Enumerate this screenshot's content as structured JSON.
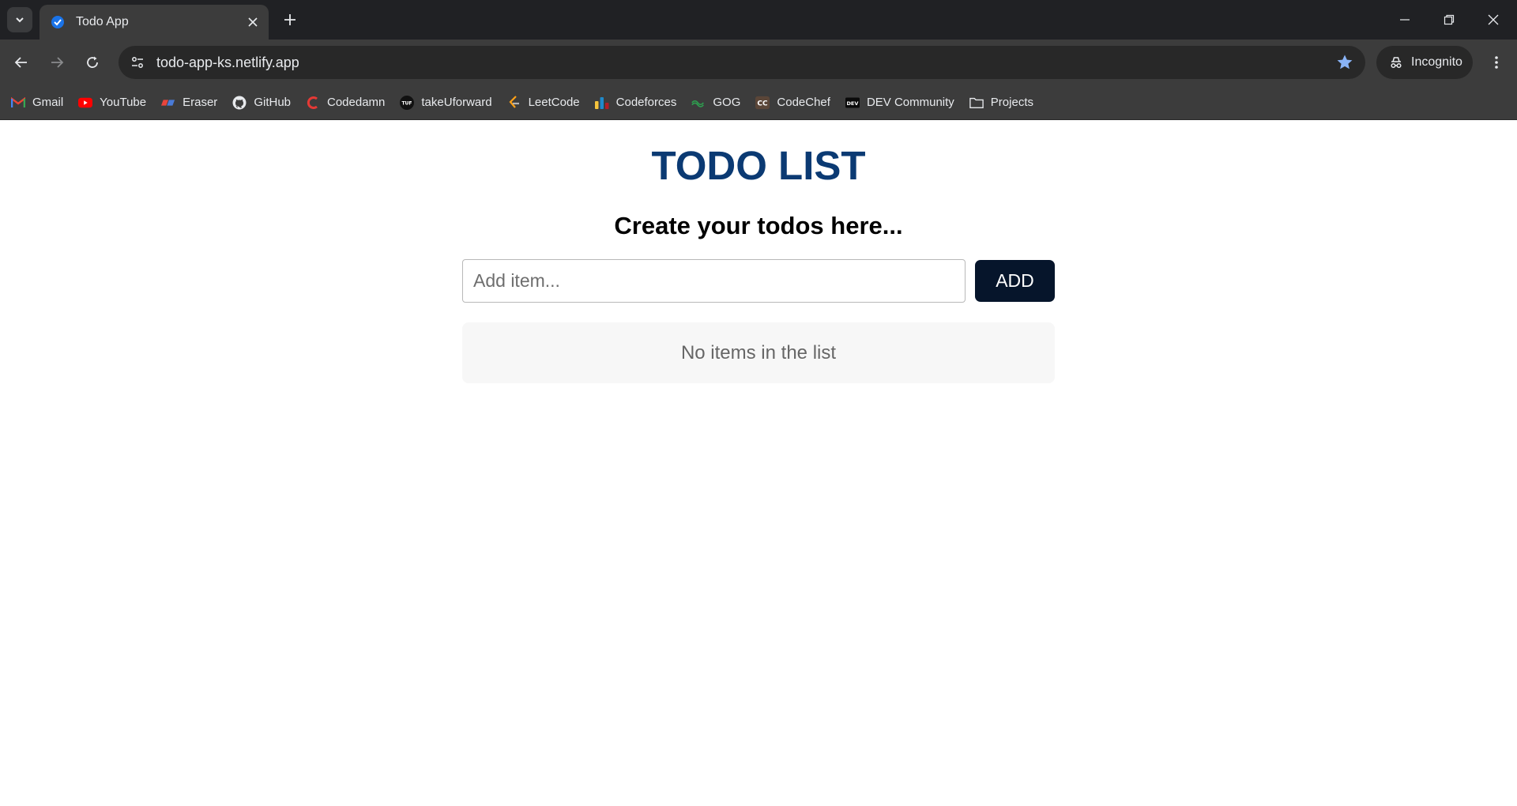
{
  "browser": {
    "tab": {
      "title": "Todo App"
    },
    "url": "todo-app-ks.netlify.app",
    "incognito_label": "Incognito",
    "bookmarks": [
      {
        "label": "Gmail",
        "icon": "gmail-icon"
      },
      {
        "label": "YouTube",
        "icon": "youtube-icon"
      },
      {
        "label": "Eraser",
        "icon": "eraser-icon"
      },
      {
        "label": "GitHub",
        "icon": "github-icon"
      },
      {
        "label": "Codedamn",
        "icon": "codedamn-icon"
      },
      {
        "label": "takeUforward",
        "icon": "takeuforward-icon"
      },
      {
        "label": "LeetCode",
        "icon": "leetcode-icon"
      },
      {
        "label": "Codeforces",
        "icon": "codeforces-icon"
      },
      {
        "label": "GOG",
        "icon": "gog-icon"
      },
      {
        "label": "CodeChef",
        "icon": "codechef-icon"
      },
      {
        "label": "DEV Community",
        "icon": "dev-icon"
      },
      {
        "label": "Projects",
        "icon": "folder-icon"
      }
    ]
  },
  "app": {
    "title": "TODO LIST",
    "subtitle": "Create your todos here...",
    "input": {
      "placeholder": "Add item...",
      "value": ""
    },
    "add_label": "ADD",
    "empty_message": "No items in the list"
  },
  "colors": {
    "heading": "#0b3a73",
    "add_button": "#06152b",
    "empty_box": "#f7f7f7"
  }
}
